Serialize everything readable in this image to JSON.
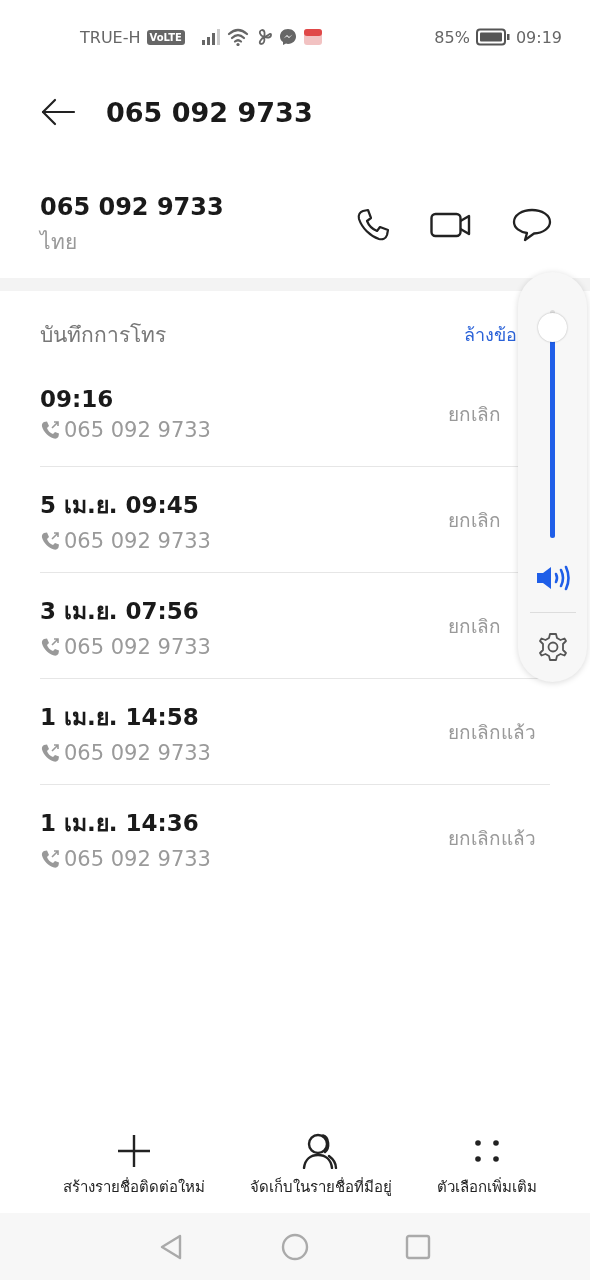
{
  "status_bar": {
    "carrier": "TRUE-H",
    "network_badge": "VoLTE",
    "battery_percent": "85%",
    "time": "09:19"
  },
  "header": {
    "title": "065 092 9733"
  },
  "contact": {
    "number": "065 092 9733",
    "location": "ไทย",
    "actions": [
      {
        "kind": "call"
      },
      {
        "kind": "video"
      },
      {
        "kind": "message"
      }
    ]
  },
  "call_log": {
    "title": "บันทึกการโทร",
    "clear_link": "ล้างข้อ",
    "entries": [
      {
        "time": "09:16",
        "number": "065 092 9733",
        "status": "ยกเลิก"
      },
      {
        "time": "5 เม.ย. 09:45",
        "number": "065 092 9733",
        "status": "ยกเลิก"
      },
      {
        "time": "3 เม.ย. 07:56",
        "number": "065 092 9733",
        "status": "ยกเลิก"
      },
      {
        "time": "1 เม.ย. 14:58",
        "number": "065 092 9733",
        "status": "ยกเลิกแล้ว"
      },
      {
        "time": "1 เม.ย. 14:36",
        "number": "065 092 9733",
        "status": "ยกเลิกแล้ว"
      }
    ]
  },
  "volume_panel": {
    "level": 0.92
  },
  "bottom_actions": [
    {
      "kind": "add",
      "label": "สร้างรายชื่อติดต่อใหม่"
    },
    {
      "kind": "person",
      "label": "จัดเก็บในรายชื่อที่มีอยู่"
    },
    {
      "kind": "more",
      "label": "ตัวเลือกเพิ่มเติม"
    }
  ],
  "nav_bar": [
    {
      "kind": "back"
    },
    {
      "kind": "home"
    },
    {
      "kind": "recents"
    }
  ]
}
